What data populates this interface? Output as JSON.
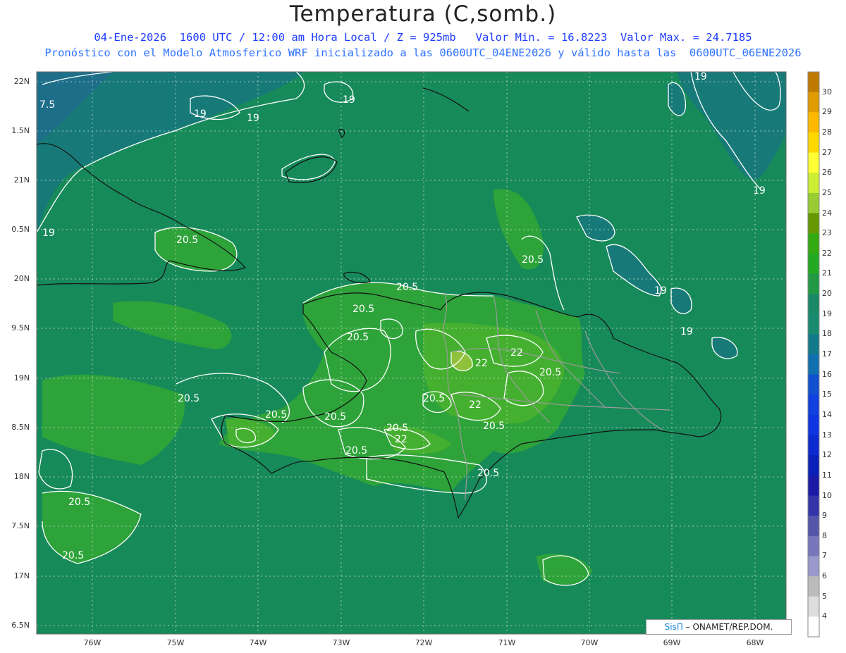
{
  "title": "Temperatura (C,somb.)",
  "subtitle_line1": "04-Ene-2026  1600 UTC / 12:00 am Hora Local / Z = 925mb   Valor Min. = 16.8223  Valor Max. = 24.7185",
  "subtitle_line2": "Pronóstico con el Modelo Atmosferico WRF inicializado a las 0600UTC_04ENE2026 y válido hasta las  0600UTC_06ENE2026",
  "credit": {
    "logo": "SisΠ",
    "text": "– ONAMET/REP.DOM."
  },
  "axis": {
    "lat_labels": [
      "22N",
      "1.5N",
      "21N",
      "0.5N",
      "20N",
      "9.5N",
      "19N",
      "8.5N",
      "18N",
      "7.5N",
      "17N",
      "6.5N"
    ],
    "lon_labels": [
      "76W",
      "75W",
      "74W",
      "73W",
      "72W",
      "71W",
      "70W",
      "69W",
      "68W"
    ]
  },
  "colorbar": {
    "labels": [
      "30",
      "29",
      "28",
      "27",
      "26",
      "25",
      "24",
      "23",
      "22",
      "21",
      "20",
      "19",
      "18",
      "17",
      "16",
      "15",
      "14",
      "13",
      "12",
      "11",
      "10",
      "9",
      "8",
      "7",
      "6",
      "5",
      "4"
    ],
    "colors": [
      "#c07a00",
      "#e09b00",
      "#ffb800",
      "#ffd800",
      "#ffff33",
      "#ccee33",
      "#99cc33",
      "#669900",
      "#33aa11",
      "#22aa22",
      "#229944",
      "#1a8866",
      "#178a70",
      "#147a8a",
      "#1170b0",
      "#1050d0",
      "#1040dd",
      "#0e35e0",
      "#0c2ad0",
      "#0a20b8",
      "#1a1aa6",
      "#3333aa",
      "#5555aa",
      "#7777bb",
      "#9999cc",
      "#bbbbbb",
      "#dddddd",
      "#ffffff"
    ]
  },
  "contour_labels": [
    {
      "text": "7.5"
    },
    {
      "text": "19"
    },
    {
      "text": "19"
    },
    {
      "text": "19"
    },
    {
      "text": "19"
    },
    {
      "text": "19"
    },
    {
      "text": "19"
    },
    {
      "text": "19"
    },
    {
      "text": "19"
    },
    {
      "text": "20.5"
    },
    {
      "text": "20.5"
    },
    {
      "text": "20.5"
    },
    {
      "text": "20.5"
    },
    {
      "text": "20.5"
    },
    {
      "text": "20.5"
    },
    {
      "text": "20.5"
    },
    {
      "text": "20.5"
    },
    {
      "text": "20.5"
    },
    {
      "text": "20.5"
    },
    {
      "text": "20.5"
    },
    {
      "text": "20.5"
    },
    {
      "text": "20.5"
    },
    {
      "text": "20.5"
    },
    {
      "text": "20.5"
    },
    {
      "text": "20.5"
    },
    {
      "text": "22"
    },
    {
      "text": "22"
    },
    {
      "text": "22"
    },
    {
      "text": "22"
    }
  ],
  "field_colors": {
    "base": "#178a5a",
    "cool": "#177a78",
    "warm": "#2ea33a",
    "warmer": "#45b030",
    "hot": "#8fc23a"
  }
}
